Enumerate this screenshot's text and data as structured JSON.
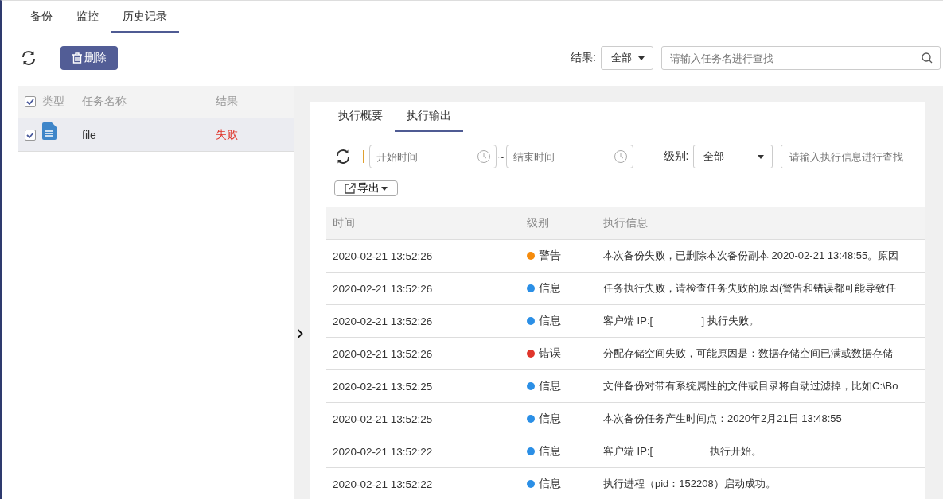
{
  "tabs": [
    {
      "label": "备份",
      "selected": false
    },
    {
      "label": "监控",
      "selected": false
    },
    {
      "label": "历史记录",
      "selected": true
    }
  ],
  "toolbar": {
    "delete_button": "删除",
    "result_filter": {
      "label": "结果:",
      "value": "全部"
    },
    "search": {
      "placeholder": "请输入任务名进行查找"
    }
  },
  "task_table": {
    "all_checked": true,
    "columns": [
      "类型",
      "任务名称",
      "结果"
    ],
    "rows": [
      {
        "checked": true,
        "selected": true,
        "name": "file",
        "result": "失败"
      }
    ]
  },
  "detail": {
    "tabs": [
      {
        "label": "执行概要",
        "selected": false
      },
      {
        "label": "执行输出",
        "selected": true
      }
    ],
    "start_time": {
      "placeholder": "开始时间"
    },
    "separator": "~",
    "end_time": {
      "placeholder": "结束时间"
    },
    "level_filter": {
      "label": "级别:",
      "value": "全部"
    },
    "search": {
      "placeholder": "请输入执行信息进行查找"
    },
    "export_button": "导出",
    "log_table": {
      "columns": [
        "时间",
        "级别",
        "执行信息"
      ],
      "rows": [
        {
          "time": "2020-02-21 13:52:26",
          "level": "警告",
          "color": "#f58b0c",
          "message": "本次备份失败，已删除本次备份副本 2020-02-21 13:48:55。原因"
        },
        {
          "time": "2020-02-21 13:52:26",
          "level": "信息",
          "color": "#2b8fe6",
          "message": "任务执行失败，请检查任务失败的原因(警告和错误都可能导致任"
        },
        {
          "time": "2020-02-21 13:52:26",
          "level": "信息",
          "color": "#2b8fe6",
          "message": "客户端 IP:[                 ] 执行失败。"
        },
        {
          "time": "2020-02-21 13:52:26",
          "level": "错误",
          "color": "#e0352b",
          "message": "分配存储空间失败，可能原因是：数据存储空间已满或数据存储"
        },
        {
          "time": "2020-02-21 13:52:25",
          "level": "信息",
          "color": "#2b8fe6",
          "message": "文件备份对带有系统属性的文件或目录将自动过滤掉，比如C:\\Bo"
        },
        {
          "time": "2020-02-21 13:52:25",
          "level": "信息",
          "color": "#2b8fe6",
          "message": "本次备份任务产生时间点：2020年2月21日 13:48:55"
        },
        {
          "time": "2020-02-21 13:52:22",
          "level": "信息",
          "color": "#2b8fe6",
          "message": "客户端 IP:[                    执行开始。"
        },
        {
          "time": "2020-02-21 13:52:22",
          "level": "信息",
          "color": "#2b8fe6",
          "message": "执行进程（pid：152208）启动成功。"
        }
      ]
    }
  }
}
